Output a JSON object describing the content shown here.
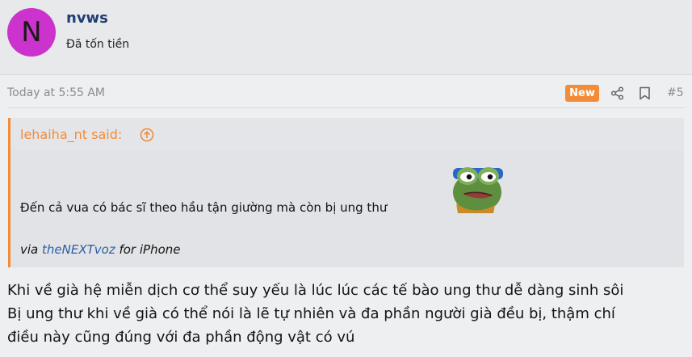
{
  "user": {
    "avatar_letter": "N",
    "avatar_color": "#cc33cc",
    "username": "nvws",
    "title": "Đã tốn tiền"
  },
  "post": {
    "timestamp": "Today at 5:55 AM",
    "badge": "New",
    "number": "#5",
    "share_icon": "share-icon",
    "bookmark_icon": "bookmark-icon"
  },
  "quote": {
    "author": "lehaiha_nt said:",
    "text": "Đến cả vua có bác sĩ theo hầu tận giường mà còn bị ung thư",
    "via_prefix": "via ",
    "via_app": "theNEXTvoz",
    "via_suffix": " for iPhone",
    "accent_color": "#f28c38"
  },
  "body": {
    "lines": [
      "Khi về già hệ miễn dịch cơ thể suy yếu là lúc lúc các tế bào ung thư dễ dàng sinh sôi",
      "Bị ung thư khi về già có thể nói là lẽ tự nhiên và đa phần người già đều bị, thậm chí",
      "điều này cũng đúng với đa phần động vật có vú"
    ]
  }
}
